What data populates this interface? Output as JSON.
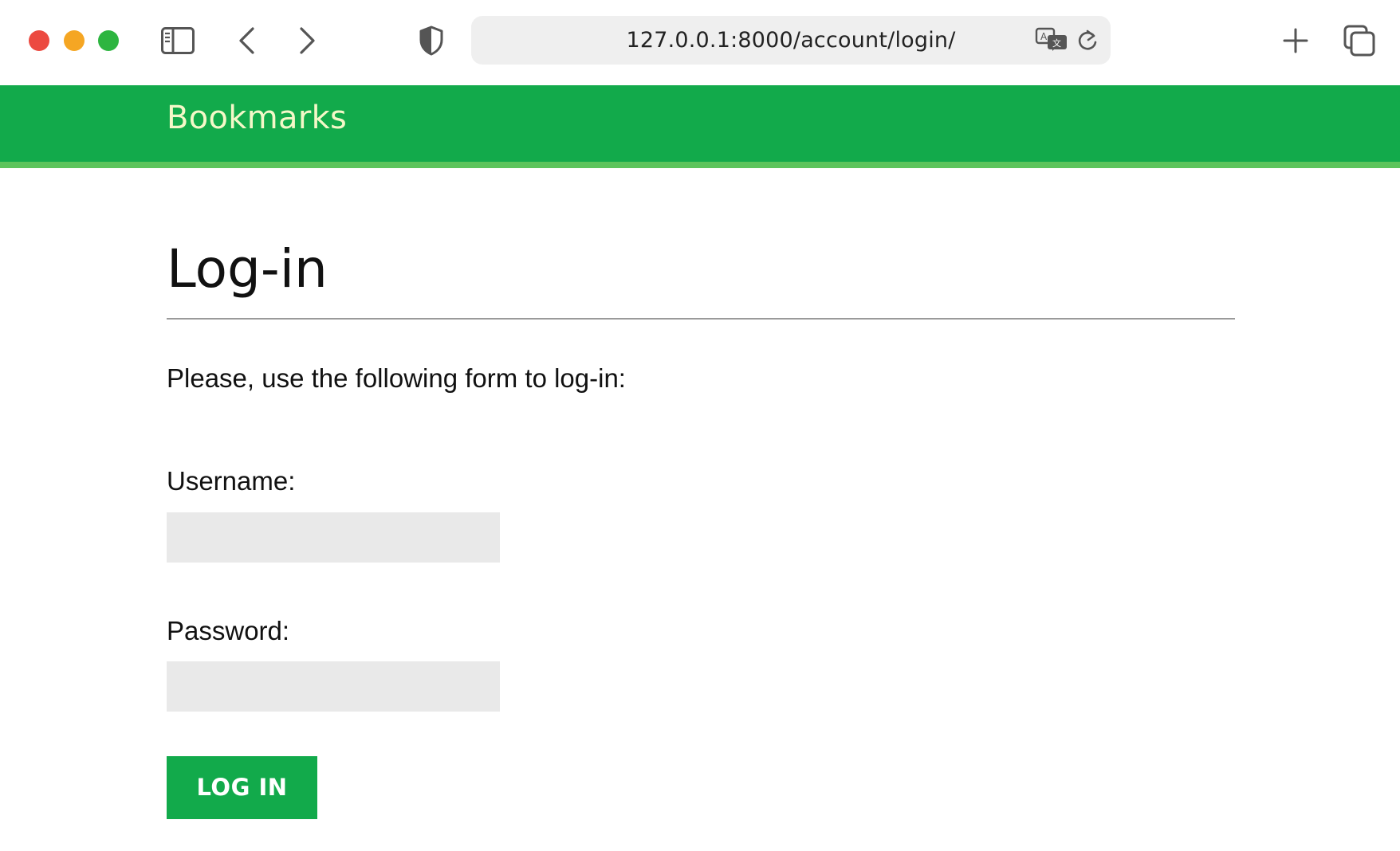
{
  "browser": {
    "address": "127.0.0.1:8000/account/login/",
    "icons": {
      "close": "close-window-dot",
      "minimize": "minimize-window-dot",
      "maximize": "maximize-window-dot",
      "sidebar": "sidebar-icon",
      "back": "chevron-left-icon",
      "forward": "chevron-right-icon",
      "privacy": "shield-icon",
      "translate": "translate-icon",
      "reload": "reload-icon",
      "new_tab": "plus-icon",
      "tab_overview": "tabs-overview-icon"
    }
  },
  "site": {
    "logo": "Bookmarks"
  },
  "page": {
    "title": "Log-in",
    "intro": "Please, use the following form to log-in:",
    "form": {
      "username_label": "Username:",
      "username_value": "",
      "password_label": "Password:",
      "password_value": "",
      "submit_label": "LOG IN"
    }
  },
  "colors": {
    "brand_green": "#12aa4b",
    "header_stripe": "#5cc45c",
    "logo_text": "#f4f8c8",
    "input_bg": "#e9e9e9",
    "traffic_red": "#ec4a40",
    "traffic_yellow": "#f5a623",
    "traffic_green": "#2db540"
  }
}
